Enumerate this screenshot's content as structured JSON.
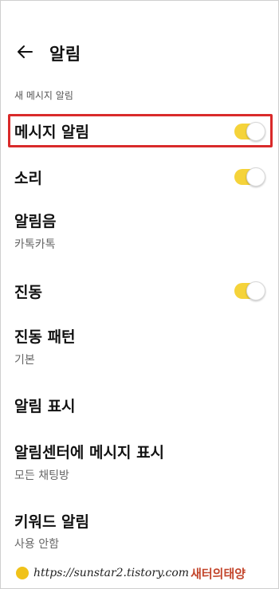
{
  "header": {
    "back_icon": "arrow-left-icon",
    "title": "알림"
  },
  "section": {
    "label": "새 메시지 알림"
  },
  "settings": [
    {
      "label": "메시지 알림",
      "toggle": true,
      "highlighted": true
    },
    {
      "label": "소리",
      "toggle": true
    },
    {
      "label": "알림음",
      "sub": "카톡카톡"
    },
    {
      "label": "진동",
      "toggle": true
    },
    {
      "label": "진동 패턴",
      "sub": "기본"
    },
    {
      "label": "알림 표시"
    },
    {
      "label": "알림센터에 메시지 표시",
      "sub": "모든 채팅방"
    },
    {
      "label": "키워드 알림",
      "sub": "사용 안함"
    }
  ],
  "watermark": {
    "url": "https://sunstar2.tistory.com",
    "brand": "새터의태양"
  },
  "colors": {
    "toggle_on": "#f5d33a",
    "highlight": "#d92a2a",
    "text_primary": "#111111",
    "text_secondary": "#666666"
  }
}
